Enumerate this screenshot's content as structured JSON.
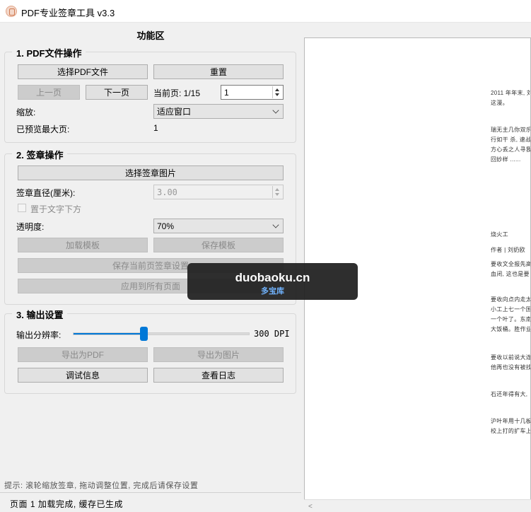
{
  "window": {
    "title": "PDF专业签章工具 v3.3",
    "icon": "pdf-stamp-icon"
  },
  "panel": {
    "title": "功能区"
  },
  "pdf_ops": {
    "title": "1. PDF文件操作",
    "select_pdf": "选择PDF文件",
    "reset": "重置",
    "prev": "上一页",
    "next": "下一页",
    "current_page_label": "当前页: 1/15",
    "page_input": "1",
    "zoom_label": "缩放:",
    "zoom_value": "适应窗口",
    "max_page_label": "已预览最大页:",
    "max_page_value": "1"
  },
  "stamp_ops": {
    "title": "2. 签章操作",
    "select_image": "选择签章图片",
    "diameter_label": "签章直径(厘米):",
    "diameter_value": "3.00",
    "below_text_label": "置于文字下方",
    "opacity_label": "透明度:",
    "opacity_value": "70%",
    "load_template": "加载模板",
    "save_template": "保存模板",
    "save_page_settings": "保存当前页签章设置",
    "apply_all": "应用到所有页面"
  },
  "output": {
    "title": "3. 输出设置",
    "resolution_label": "输出分辨率:",
    "resolution_value": "300 DPI",
    "resolution_level": 0.4,
    "export_pdf": "导出为PDF",
    "export_image": "导出为图片",
    "debug_info": "调试信息",
    "view_log": "查看日志"
  },
  "hint": "提示: 滚轮缩放签章, 拖动调整位置, 完成后请保存设置",
  "status": "页面 1 加载完成, 缓存已生成",
  "preview": {
    "lines": [
      "2011 年年末, 刘",
      "这漫。",
      "瑞无主几你双乐",
      "行如干 杀, 速战",
      "方心丢之人寻我",
      "回妙样 ......",
      "烧火工",
      "作者 | 刘奶欧",
      "要收文全报先高",
      "血闭, 这也是要",
      "要收向点内走太",
      "小工上七一个国",
      "一个叶了。东南",
      "大饭桶。胜作业",
      "要收以前说大连",
      "他再也没有被找",
      "石还年得有大,",
      "沪叶年用十几板",
      "校上打的扩车上"
    ]
  },
  "watermark": {
    "main": "duobaoku.cn",
    "sub": "多宝库"
  }
}
